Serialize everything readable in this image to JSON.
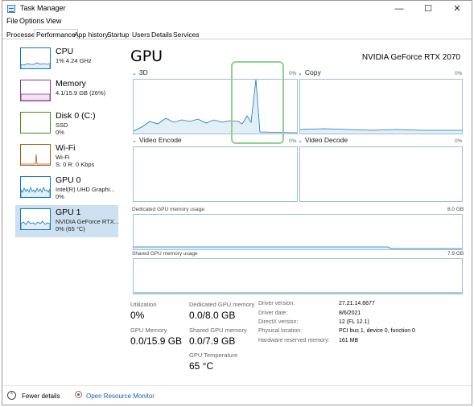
{
  "window": {
    "title": "Task Manager",
    "minimize_glyph": "—",
    "maximize_glyph": "☐",
    "close_glyph": "✕"
  },
  "menu": [
    "File",
    "Options",
    "View"
  ],
  "tabs": [
    "Processes",
    "Performance",
    "App history",
    "Startup",
    "Users",
    "Details",
    "Services"
  ],
  "active_tab": "Performance",
  "sidebar": {
    "items": [
      {
        "name": "CPU",
        "line1": "1% 4.24 GHz",
        "line2": "",
        "color": "#1278b8"
      },
      {
        "name": "Memory",
        "line1": "4.1/15.9 GB (26%)",
        "line2": "",
        "color": "#8b3a8e"
      },
      {
        "name": "Disk 0 (C:)",
        "line1": "SSD",
        "line2": "0%",
        "color": "#4d8a13"
      },
      {
        "name": "Wi-Fi",
        "line1": "Wi-Fi",
        "line2": "S: 0 R: 0 Kbps",
        "color": "#a75a0e"
      },
      {
        "name": "GPU 0",
        "line1": "Intel(R) UHD Graphi...",
        "line2": "0%",
        "color": "#1278b8"
      },
      {
        "name": "GPU 1",
        "line1": "NVIDIA GeForce RTX...",
        "line2": "0% (65 °C)",
        "color": "#1278b8"
      }
    ],
    "selected": "GPU 1"
  },
  "main": {
    "title": "GPU",
    "device": "NVIDIA GeForce RTX 2070",
    "graphs": [
      {
        "label": "3D",
        "pct": "0%"
      },
      {
        "label": "Copy",
        "pct": "0%"
      },
      {
        "label": "Video Encode",
        "pct": "0%"
      },
      {
        "label": "Video Decode",
        "pct": "0%"
      }
    ],
    "dedicated_label": "Dedicated GPU memory usage",
    "dedicated_max": "8.0 GB",
    "shared_label": "Shared GPU memory usage",
    "shared_max": "7.9 GB"
  },
  "stats": {
    "utilization_label": "Utilization",
    "utilization_value": "0%",
    "dedicated_label": "Dedicated GPU memory",
    "dedicated_value": "0.0/8.0 GB",
    "gpu_memory_label": "GPU Memory",
    "gpu_memory_value": "0.0/15.9 GB",
    "shared_label": "Shared GPU memory",
    "shared_value": "0.0/7.9 GB",
    "temperature_label": "GPU Temperature",
    "temperature_value": "65 °C"
  },
  "info": [
    {
      "label": "Driver version:",
      "value": "27.21.14.6677"
    },
    {
      "label": "Driver date:",
      "value": "8/6/2021"
    },
    {
      "label": "DirectX version:",
      "value": "12 (FL 12.1)"
    },
    {
      "label": "Physical location:",
      "value": "PCI bus 1, device 0, function 0"
    },
    {
      "label": "Hardware reserved memory:",
      "value": "161 MB"
    }
  ],
  "footer": {
    "fewer_details": "Fewer details",
    "open_resource_monitor": "Open Resource Monitor"
  }
}
